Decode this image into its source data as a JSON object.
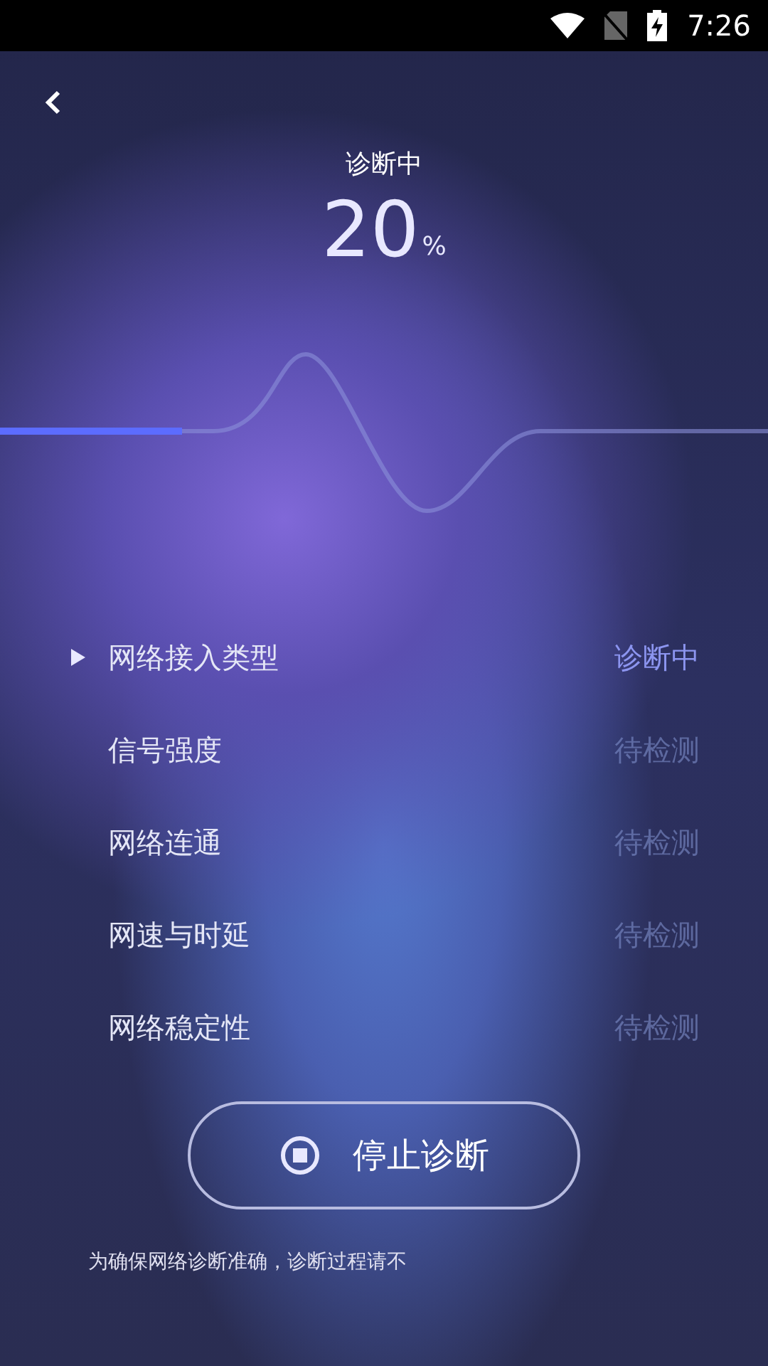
{
  "status_bar": {
    "time": "7:26"
  },
  "header": {
    "title": "诊断中",
    "percent": "20",
    "percent_unit": "%"
  },
  "checks": [
    {
      "label": "网络接入类型",
      "status": "诊断中",
      "selected": true
    },
    {
      "label": "信号强度",
      "status": "待检测",
      "selected": false
    },
    {
      "label": "网络连通",
      "status": "待检测",
      "selected": false
    },
    {
      "label": "网速与时延",
      "status": "待检测",
      "selected": false
    },
    {
      "label": "网络稳定性",
      "status": "待检测",
      "selected": false
    }
  ],
  "stop_button": {
    "label": "停止诊断"
  },
  "footer_note": "为确保网络诊断准确，诊断过程请不"
}
